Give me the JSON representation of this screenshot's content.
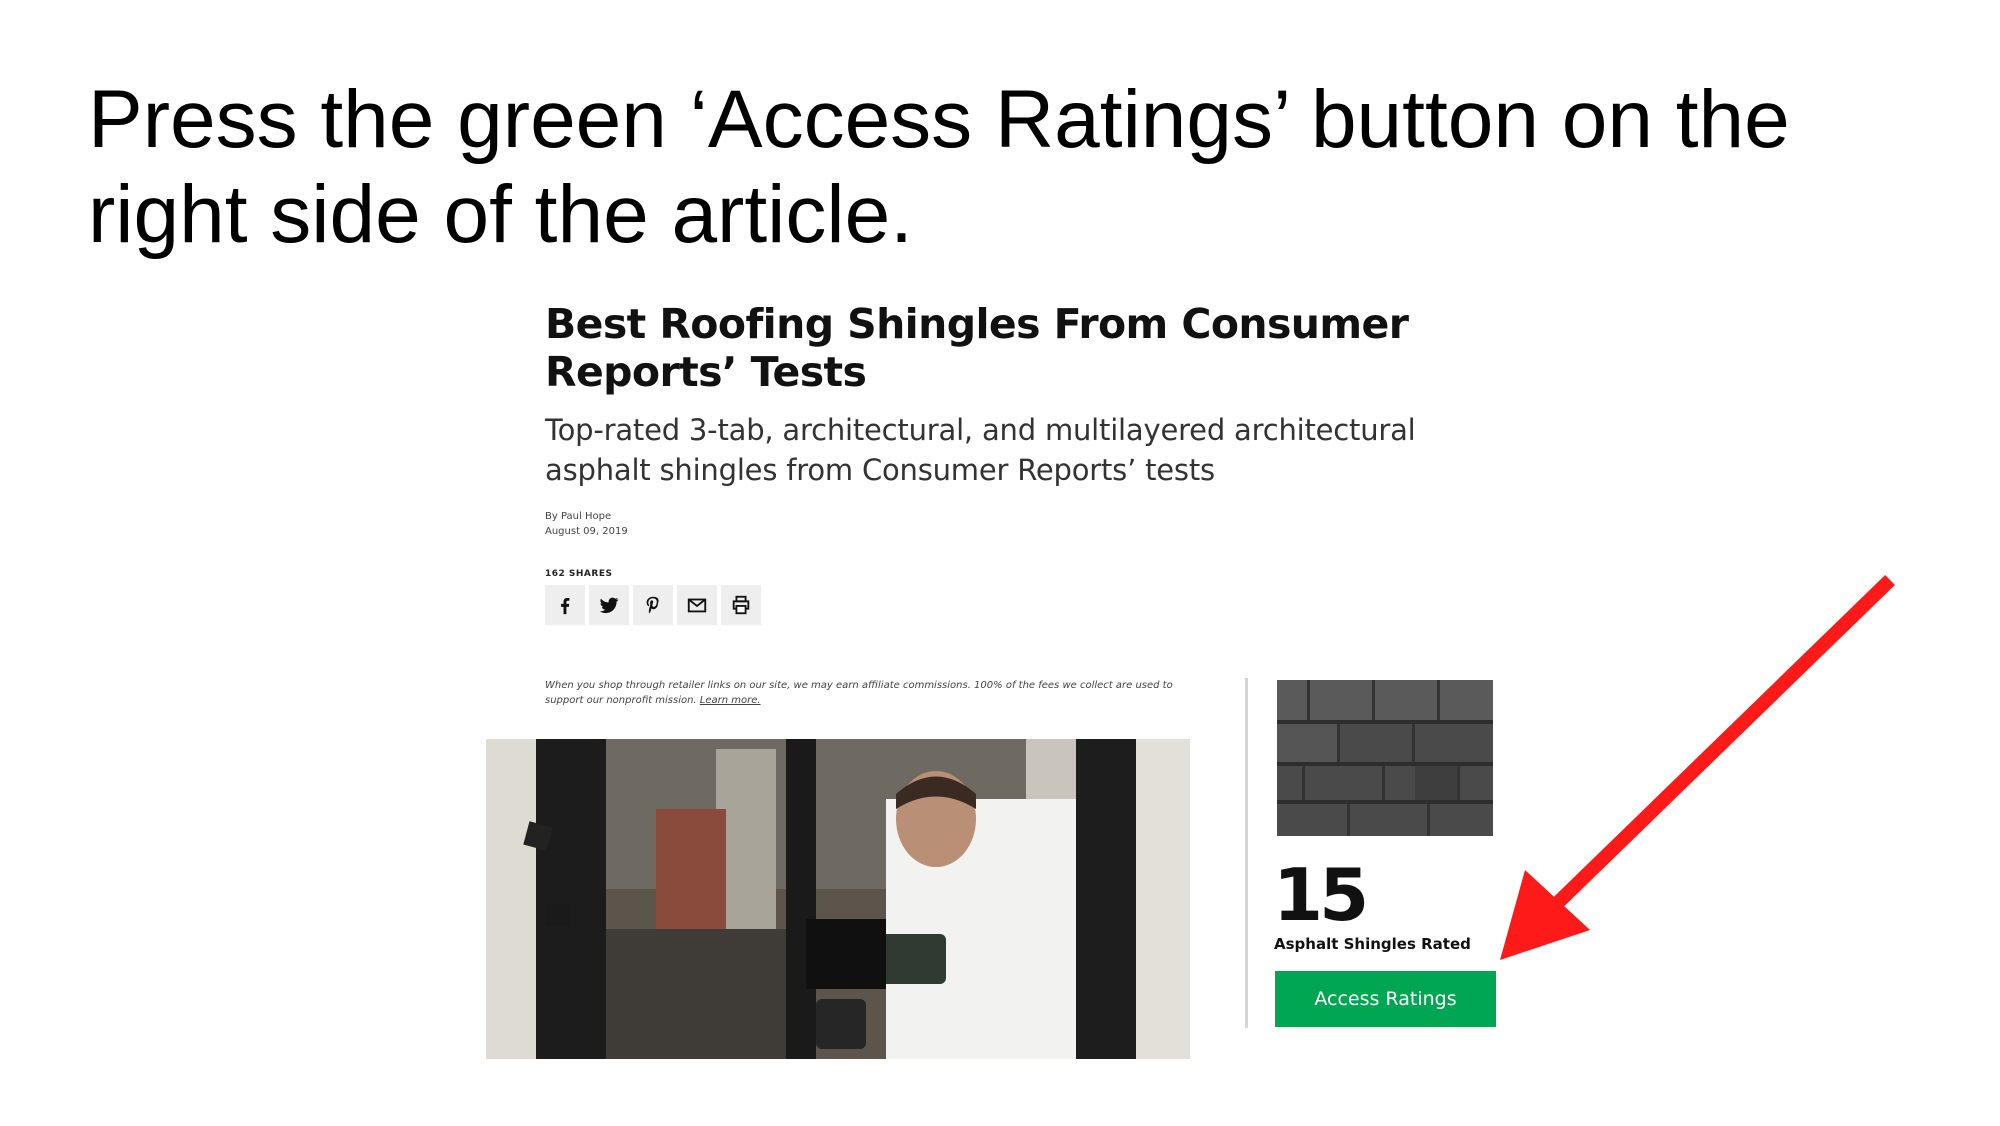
{
  "instruction": "Press the green ‘Access Ratings’ button on the right side of the article.",
  "article": {
    "title": "Best Roofing Shingles From Consumer Reports’ Tests",
    "subtitle": "Top-rated 3-tab, architectural, and multilayered architectural asphalt shingles from Consumer Reports’ tests",
    "author": "By Paul Hope",
    "date": "August 09, 2019",
    "shares": "162 SHARES",
    "share_icons": [
      "facebook-icon",
      "twitter-icon",
      "pinterest-icon",
      "email-icon",
      "print-icon"
    ],
    "disclaimer": "When you shop through retailer links on our site, we may earn affiliate commissions. 100% of the fees we collect are used to support our nonprofit mission.",
    "learn_more": "Learn more."
  },
  "ratings_panel": {
    "count": "15",
    "label": "Asphalt Shingles Rated",
    "button_label": "Access Ratings"
  },
  "colors": {
    "button_green": "#00a651",
    "arrow_red": "#ff1a1a"
  }
}
